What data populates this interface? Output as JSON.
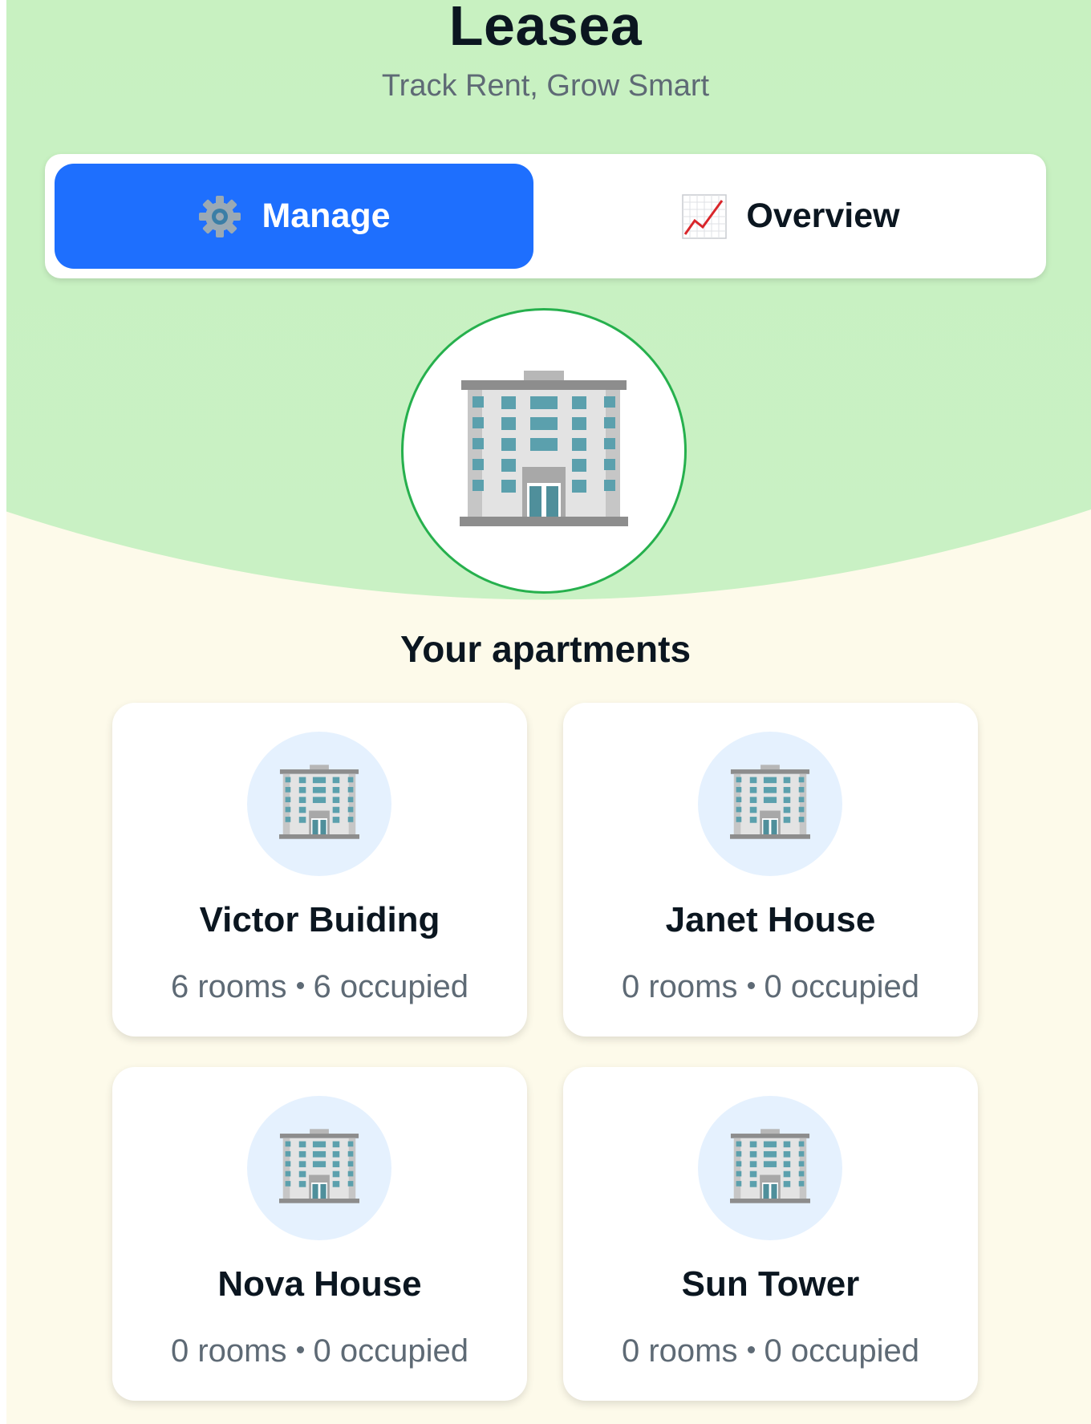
{
  "header": {
    "app_title": "Leasea",
    "tagline": "Track Rent, Grow Smart"
  },
  "tabs": [
    {
      "label": "Manage",
      "icon": "gear-icon",
      "active": true
    },
    {
      "label": "Overview",
      "icon": "chart-increasing-icon",
      "active": false
    }
  ],
  "hero": {
    "icon": "office-building-icon"
  },
  "section": {
    "title": "Your apartments"
  },
  "apartments": [
    {
      "name": "Victor Buiding",
      "rooms": "6 rooms",
      "occupied": "6 occupied"
    },
    {
      "name": "Janet House",
      "rooms": "0 rooms",
      "occupied": "0 occupied"
    },
    {
      "name": "Nova House",
      "rooms": "0 rooms",
      "occupied": "0 occupied"
    },
    {
      "name": "Sun Tower",
      "rooms": "0 rooms",
      "occupied": "0 occupied"
    }
  ],
  "colors": {
    "accent": "#1e6ffe",
    "hero_green": "#c8f1c1",
    "page_bg": "#fdfaea",
    "circle_border": "#26b04d",
    "icon_circle_bg": "#e5f1fe"
  }
}
